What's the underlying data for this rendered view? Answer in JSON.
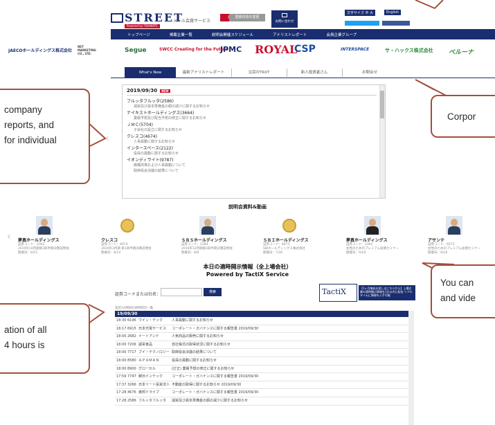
{
  "header": {
    "logo_text": "STREET",
    "logo_sub": "Powered by FISHWATE",
    "member_text": "メール会員サービス",
    "register_label": "会員登録申請",
    "change_label": "登録内容の変更",
    "contact_label": "お問い合わせ",
    "fontsize_label": "文字サイズ 中 大",
    "english_label": "English"
  },
  "nav": {
    "items": [
      "トップページ",
      "掲載企業一覧",
      "説明会開催スケジュール",
      "アナリストレポート",
      "会員企業グループ"
    ]
  },
  "sponsors": [
    {
      "name": "JAECOホールディングス株式会社",
      "color": "#1a2d6e"
    },
    {
      "name": "NET MARKETING CO., LTD.",
      "color": "#444444"
    },
    {
      "name": "Segue",
      "color": "#2d6e3a"
    },
    {
      "name": "SWCC Creating for the Future",
      "color": "#c8102e"
    },
    {
      "name": "JPMC",
      "color": "#1a2d6e"
    },
    {
      "name": "ROYAL",
      "color": "#c8102e"
    },
    {
      "name": "CSP",
      "color": "#1a4ea0"
    },
    {
      "name": "INTERSPACE",
      "color": "#1a4ea0"
    },
    {
      "name": "サ・ハックス株式会社",
      "color": "#2d8a3a"
    },
    {
      "name": "ベルーナ",
      "color": "#2d8a3a"
    }
  ],
  "tabs": [
    "What's New",
    "最新アナリストレポート",
    "注目のTRXT",
    "新人投資者さん",
    "お問合せ"
  ],
  "news": {
    "date": "2019/09/30",
    "badge": "NEW",
    "entries": [
      {
        "company": "フルッタフルッタ(2586)",
        "lines": [
          "減資及び資本準備金の額の減少に関するお知らせ"
        ]
      },
      {
        "company": "ナイキストホールディングス(3664)",
        "lines": [
          "業績予想及び配当予想の修正に関するお知らせ"
        ]
      },
      {
        "company": "ＪＭＣ(5704)",
        "lines": [
          "子会社の設立に関するお知らせ"
        ]
      },
      {
        "company": "クレスコ(4674)",
        "lines": [
          "人事異動に関するお知らせ"
        ]
      },
      {
        "company": "インタースペース(2122)",
        "lines": [
          "役員の異動に関するお知らせ"
        ]
      },
      {
        "company": "イオンディライト(9787)",
        "lines": [
          "機構改革および人事異動について",
          "取締役会決議の結果について"
        ]
      }
    ]
  },
  "briefings": {
    "title": "説明会資料&動画",
    "items": [
      {
        "name": "夢真ホールディングス",
        "code": "証券コード：2362",
        "desc": "2019年10月期第3四半期決算説明会",
        "date": "開催日：8/15",
        "kind": "photo"
      },
      {
        "name": "クレスコ",
        "code": "証券コード：4674",
        "desc": "2020年3月期 第1四半期決算説明会",
        "date": "開催日：8/14",
        "kind": "medal"
      },
      {
        "name": "ＳＢＳホールディングス",
        "code": "証券コード：2384",
        "desc": "2019年12月期第2四半期決算説明会",
        "date": "開催日：8/9",
        "kind": "photo"
      },
      {
        "name": "ＳＢＩホールディングス",
        "code": "証券コード：8473",
        "desc": "SBIホールディングス株式会社",
        "date": "開催日：7/30",
        "kind": "medal"
      },
      {
        "name": "夢真ホールディングス",
        "code": "証券コード：2362",
        "desc": "女性のためのプレミアム投資セミナー",
        "date": "開催日：9/18",
        "kind": "photo"
      },
      {
        "name": "アサンテ",
        "code": "証券コード：6073",
        "desc": "女性のためのプレミアム投資セミナー",
        "date": "開催日：9/18",
        "kind": "photo"
      }
    ]
  },
  "disclosure": {
    "title": "本日の適時開示情報（全上場会社）",
    "subtitle": "Powered by TactiX Service",
    "code_label": "証券コードまたは社名：",
    "search_label": "検索",
    "tactix_logo": "TactiX",
    "tactix_info": "【1ヶ月無料お試しはこちらから】上場企業の適時開示情報を1分以内に配信 リアルタイムに情報を入手可能",
    "caption": "直近24時間の適時開示一覧",
    "date_head": "19/09/30",
    "rows": [
      {
        "time": "18:30",
        "code": "6196",
        "name": "ワイン・テック",
        "title": "人事異動に関するお知らせ"
      },
      {
        "time": "18:17",
        "code": "6915",
        "name": "日本光電サービス",
        "title": "コーポレート・ガバナンスに関する報告書 2019/09/30"
      },
      {
        "time": "18:00",
        "code": "2682",
        "name": "イートアンド",
        "title": "人気商品の販売に関するお知らせ"
      },
      {
        "time": "18:00",
        "code": "7206",
        "name": "誠栄食品",
        "title": "自社株式の取得状況に関するお知らせ"
      },
      {
        "time": "18:00",
        "code": "7717",
        "name": "ブイ・テクノロジー",
        "title": "取締役会決議の結果について"
      },
      {
        "time": "18:00",
        "code": "8580",
        "name": "ＡＰＡＭＡＮ",
        "title": "役員の異動に関するお知らせ"
      },
      {
        "time": "18:00",
        "code": "8900",
        "name": "グローセル",
        "title": "(訂正) 業績予想の修正に関するお知らせ"
      },
      {
        "time": "17:59",
        "code": "7747",
        "name": "朝日インテック",
        "title": "コーポレート・ガバナンスに関する報告書 2019/09/30"
      },
      {
        "time": "17:37",
        "code": "3266",
        "name": "日本リート投資法人",
        "title": "不動産の取得に関するお知らせ 2019/09/30"
      },
      {
        "time": "17:28",
        "code": "4676",
        "name": "東邦ドライブ",
        "title": "コーポレート・ガバナンスに関する報告書 2019/09/30"
      },
      {
        "time": "17:28",
        "code": "2586",
        "name": "フルッタフルッタ",
        "title": "減資及び資本準備金の額の減少に関するお知らせ"
      }
    ]
  },
  "callouts": {
    "left_top": "company\nreports, and\nfor individual",
    "right_mid": "Corpor",
    "right_bottom": "You can\nand vide",
    "left_bottom": "ation of all\n4 hours is"
  }
}
